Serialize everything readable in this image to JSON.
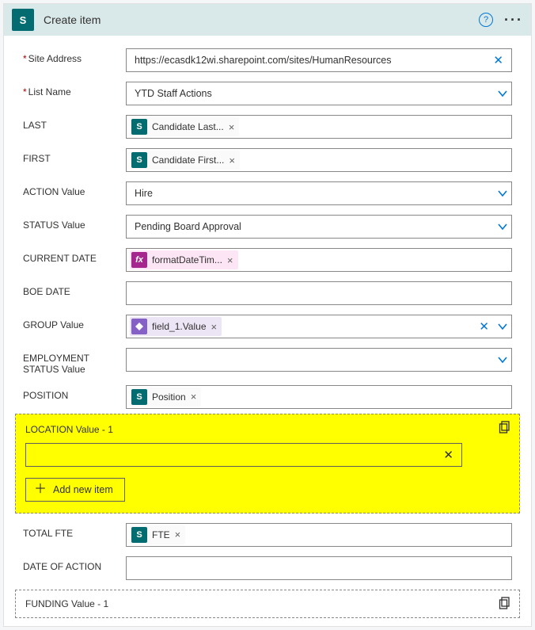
{
  "header": {
    "title": "Create item",
    "app_icon_text": "S"
  },
  "fields": {
    "site_address": {
      "label": "Site Address",
      "required": true,
      "value": "https://ecasdk12wi.sharepoint.com/sites/HumanResources"
    },
    "list_name": {
      "label": "List Name",
      "required": true,
      "value": "YTD Staff Actions"
    },
    "last": {
      "label": "LAST",
      "token": "Candidate Last..."
    },
    "first": {
      "label": "FIRST",
      "token": "Candidate First..."
    },
    "action": {
      "label": "ACTION Value",
      "value": "Hire"
    },
    "status": {
      "label": "STATUS Value",
      "value": "Pending Board Approval"
    },
    "current_date": {
      "label": "CURRENT DATE",
      "token": "formatDateTim..."
    },
    "boe_date": {
      "label": "BOE DATE"
    },
    "group": {
      "label": "GROUP Value",
      "token": "field_1.Value"
    },
    "emp_status": {
      "label": "EMPLOYMENT STATUS Value"
    },
    "position": {
      "label": "POSITION",
      "token": "Position"
    },
    "location_grp": {
      "label": "LOCATION Value - 1",
      "add": "Add new item"
    },
    "total_fte": {
      "label": "TOTAL FTE",
      "token": "FTE"
    },
    "date_action": {
      "label": "DATE OF ACTION"
    },
    "funding_grp": {
      "label": "FUNDING Value - 1"
    }
  }
}
